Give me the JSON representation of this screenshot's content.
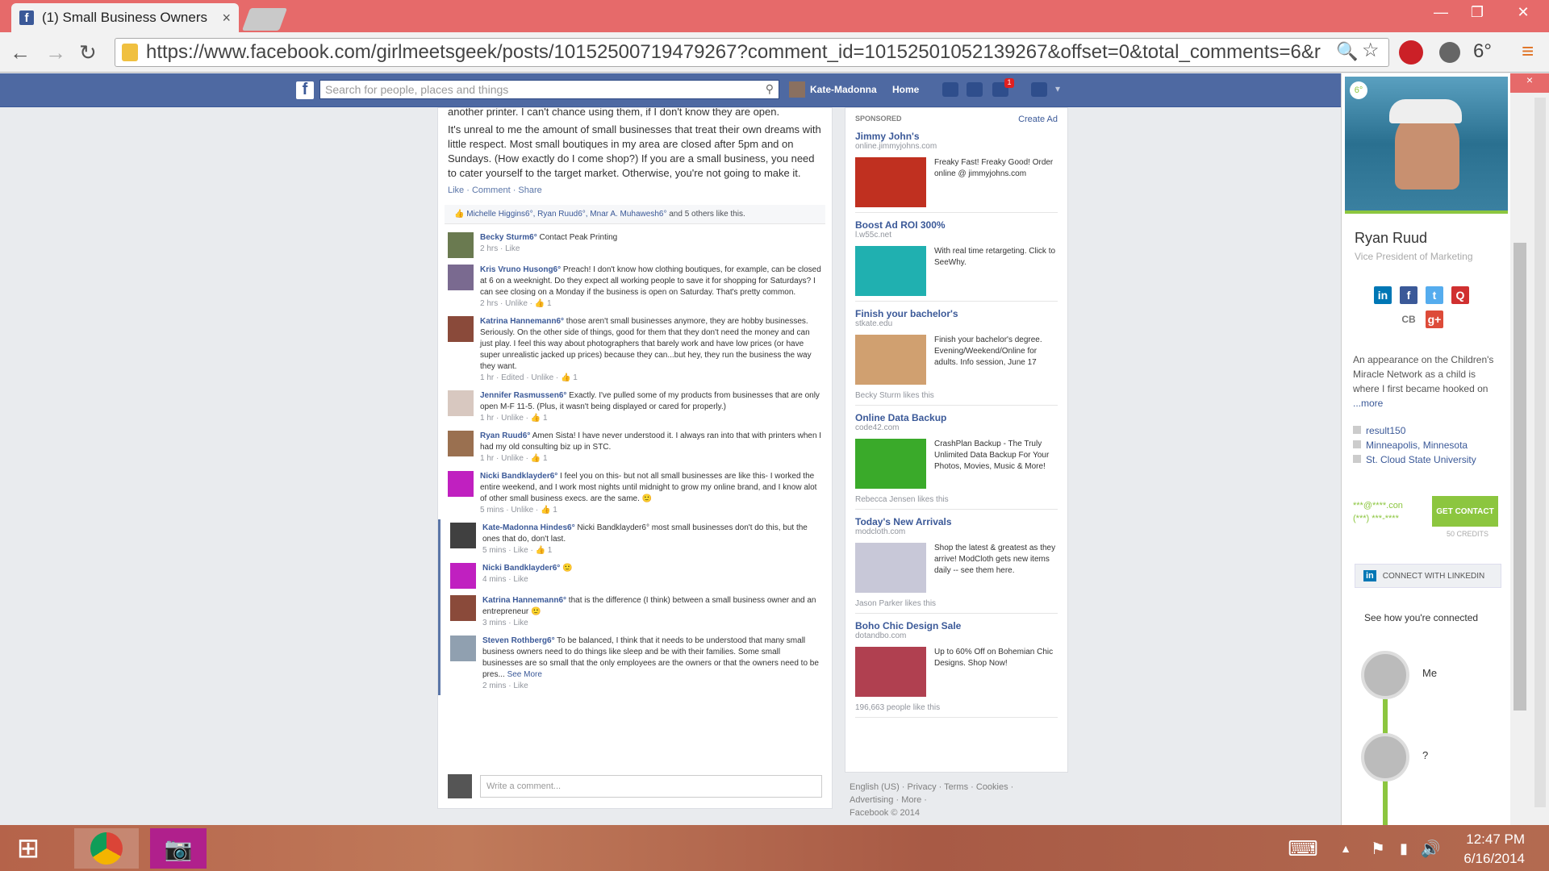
{
  "browser": {
    "tab_title": "(1) Small Business Owners",
    "tab_close": "×",
    "url": "https://www.facebook.com/girlmeetsgeek/posts/10152500719479267?comment_id=10152501052139267&offset=0&total_comments=6&r",
    "minimize": "—",
    "restore": "❐",
    "close": "✕",
    "ext_badge": "6°"
  },
  "fb": {
    "logo": "f",
    "search_placeholder": "Search for people, places and things",
    "user": "Kate-Madonna",
    "home": "Home",
    "notif_count": "1"
  },
  "post": {
    "text1": "another printer. I can't chance using them, if I don't know they are open.",
    "text2": "It's unreal to me the amount of small businesses that treat their own dreams with little respect. Most small boutiques in my area are closed after 5pm and on Sundays. (How exactly do I come shop?) If you are a small business, you need to cater yourself to the target market. Otherwise, you're not going to make it.",
    "actions": "Like · Comment · Share",
    "likes_names": "Michelle Higgins6°, Ryan Ruud6°, Mnar A. Muhawesh6°",
    "likes_rest": " and 5 others like this.",
    "write_placeholder": "Write a comment..."
  },
  "comments": [
    {
      "name": "Becky Sturm6°",
      "text": " Contact Peak Printing",
      "meta": "2 hrs · Like",
      "color": "#6a7a50"
    },
    {
      "name": "Kris Vruno Husong6°",
      "text": " Preach! I don't know how clothing boutiques, for example, can be closed at 6 on a weeknight. Do they expect all working people to save it for shopping for Saturdays? I can see closing on a Monday if the business is open on Saturday. That's pretty common.",
      "meta": "2 hrs · Unlike · 👍 1",
      "color": "#7a6a90"
    },
    {
      "name": "Katrina Hannemann6°",
      "text": " those aren't small businesses anymore, they are hobby businesses. Seriously. On the other side of things, good for them that they don't need the money and can just play. I feel this way about photographers that barely work and have low prices (or have super unrealistic jacked up prices) because they can...but hey, they run the business the way they want.",
      "meta": "1 hr · Edited · Unlike · 👍 1",
      "color": "#8a4a3a"
    },
    {
      "name": "Jennifer Rasmussen6°",
      "text": " Exactly. I've pulled some of my products from businesses that are only open M-F 11-5. (Plus, it wasn't being displayed or cared for properly.)",
      "meta": "1 hr · Unlike · 👍 1",
      "color": "#d8c8c0"
    },
    {
      "name": "Ryan Ruud6°",
      "text": " Amen Sista! I have never understood it. I always ran into that with printers when I had my old consulting biz up in STC.",
      "meta": "1 hr · Unlike · 👍 1",
      "color": "#9a7050"
    },
    {
      "name": "Nicki Bandklayder6°",
      "text": " I feel you on this- but not all small businesses are like this- I worked the entire weekend, and I work most nights until midnight to grow my online brand, and I know alot of other small business execs. are the same. 🙂",
      "meta": "5 mins · Unlike · 👍 1",
      "color": "#c020c0"
    },
    {
      "name": "Kate-Madonna Hindes6°",
      "text": " Nicki Bandklayder6° most small businesses don't do this, but the ones that do, don't last.",
      "meta": "5 mins · Like · 👍 1",
      "color": "#404040"
    },
    {
      "name": "Nicki Bandklayder6°",
      "text": " 🙂",
      "meta": "4 mins · Like",
      "color": "#c020c0"
    },
    {
      "name": "Katrina Hannemann6°",
      "text": " that is the difference (I think) between a small business owner and an entrepreneur 🙂",
      "meta": "3 mins · Like",
      "color": "#8a4a3a"
    },
    {
      "name": "Steven Rothberg6°",
      "text": " To be balanced, I think that it needs to be understood that many small business owners need to do things like sleep and be with their families. Some small businesses are so small that the only employees are the owners or that the owners need to be pres...",
      "see_more": "See More",
      "meta": "2 mins · Like",
      "color": "#90a0b0"
    }
  ],
  "ads": {
    "sponsored": "SPONSORED",
    "create_ad": "Create Ad",
    "items": [
      {
        "title": "Jimmy John's",
        "url": "online.jimmyjohns.com",
        "desc": "Freaky Fast! Freaky Good! Order online @ jimmyjohns.com",
        "social": "",
        "color": "#c03020"
      },
      {
        "title": "Boost Ad ROI 300%",
        "url": "l.w55c.net",
        "desc": "With real time retargeting. Click to SeeWhy.",
        "social": "",
        "color": "#20b0b0"
      },
      {
        "title": "Finish your bachelor's",
        "url": "stkate.edu",
        "desc": "Finish your bachelor's degree. Evening/Weekend/Online for adults. Info session, June 17",
        "social": "Becky Sturm likes this",
        "color": "#d0a070"
      },
      {
        "title": "Online Data Backup",
        "url": "code42.com",
        "desc": "CrashPlan Backup - The Truly Unlimited Data Backup For Your Photos, Movies, Music & More!",
        "social": "Rebecca Jensen likes this",
        "color": "#3aaa2a"
      },
      {
        "title": "Today's New Arrivals",
        "url": "modcloth.com",
        "desc": "Shop the latest & greatest as they arrive! ModCloth gets new items daily -- see them here.",
        "social": "Jason Parker likes this",
        "color": "#c8c8d8"
      },
      {
        "title": "Boho Chic Design Sale",
        "url": "dotandbo.com",
        "desc": "Up to 60% Off on Bohemian Chic Designs. Shop Now!",
        "social": "196,663 people like this",
        "color": "#b04050"
      }
    ]
  },
  "footer": {
    "line1": "English (US) · Privacy · Terms · Cookies ·",
    "line2": "Advertising · More ·",
    "line3": "Facebook © 2014"
  },
  "rapportive": {
    "badge": "6°",
    "name": "Ryan Ruud",
    "title": "Vice President of Marketing",
    "bio": "An appearance on the Children's Miracle Network as a child is where I first became hooked on",
    "more": "...more",
    "info": [
      "result150",
      "Minneapolis, Minnesota",
      "St. Cloud State University"
    ],
    "email": "***@****.con",
    "phone": "(***) ***-****",
    "get_contact": "GET CONTACT",
    "credits": "50 CREDITS",
    "connect": "CONNECT WITH LINKEDIN",
    "see_how": "See how you're connected",
    "node1": "Me",
    "node2": "?",
    "cb": "CB"
  },
  "taskbar": {
    "time": "12:47 PM",
    "date": "6/16/2014"
  }
}
